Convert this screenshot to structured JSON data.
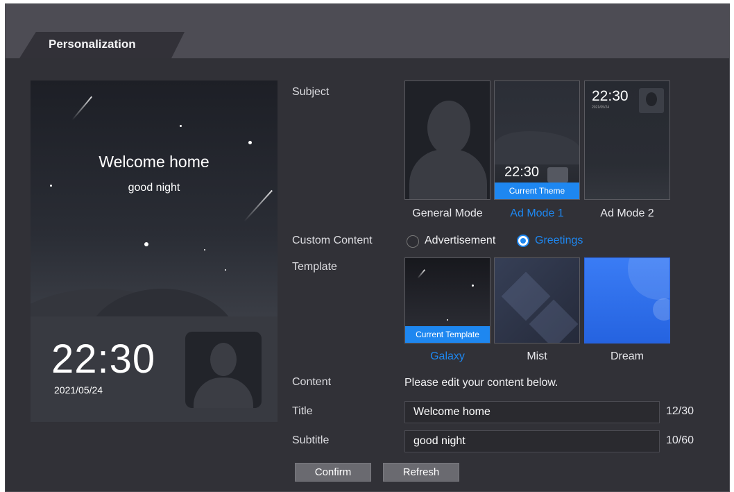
{
  "tab": {
    "label": "Personalization"
  },
  "preview": {
    "title": "Welcome home",
    "subtitle": "good night",
    "time": "22:30",
    "date": "2021/05/24"
  },
  "labels": {
    "subject": "Subject",
    "custom_content": "Custom Content",
    "template": "Template",
    "content": "Content",
    "title": "Title",
    "subtitle": "Subtitle"
  },
  "subjects": [
    {
      "label": "General Mode",
      "active": false
    },
    {
      "label": "Ad Mode 1",
      "active": true,
      "badge": "Current Theme",
      "time": "22:30"
    },
    {
      "label": "Ad Mode 2",
      "active": false,
      "time": "22:30",
      "date": "2021/05/24"
    }
  ],
  "custom_content": {
    "options": [
      {
        "label": "Advertisement",
        "selected": false
      },
      {
        "label": "Greetings",
        "selected": true
      }
    ]
  },
  "templates": [
    {
      "label": "Galaxy",
      "active": true,
      "badge": "Current Template"
    },
    {
      "label": "Mist",
      "active": false
    },
    {
      "label": "Dream",
      "active": false
    }
  ],
  "content": {
    "hint": "Please edit your content below.",
    "title_value": "Welcome home",
    "title_count": "12/30",
    "subtitle_value": "good night",
    "subtitle_count": "10/60"
  },
  "buttons": {
    "confirm": "Confirm",
    "refresh": "Refresh"
  },
  "colors": {
    "accent": "#1e87f0",
    "panel": "#313137",
    "tabbar": "#4d4c54"
  }
}
